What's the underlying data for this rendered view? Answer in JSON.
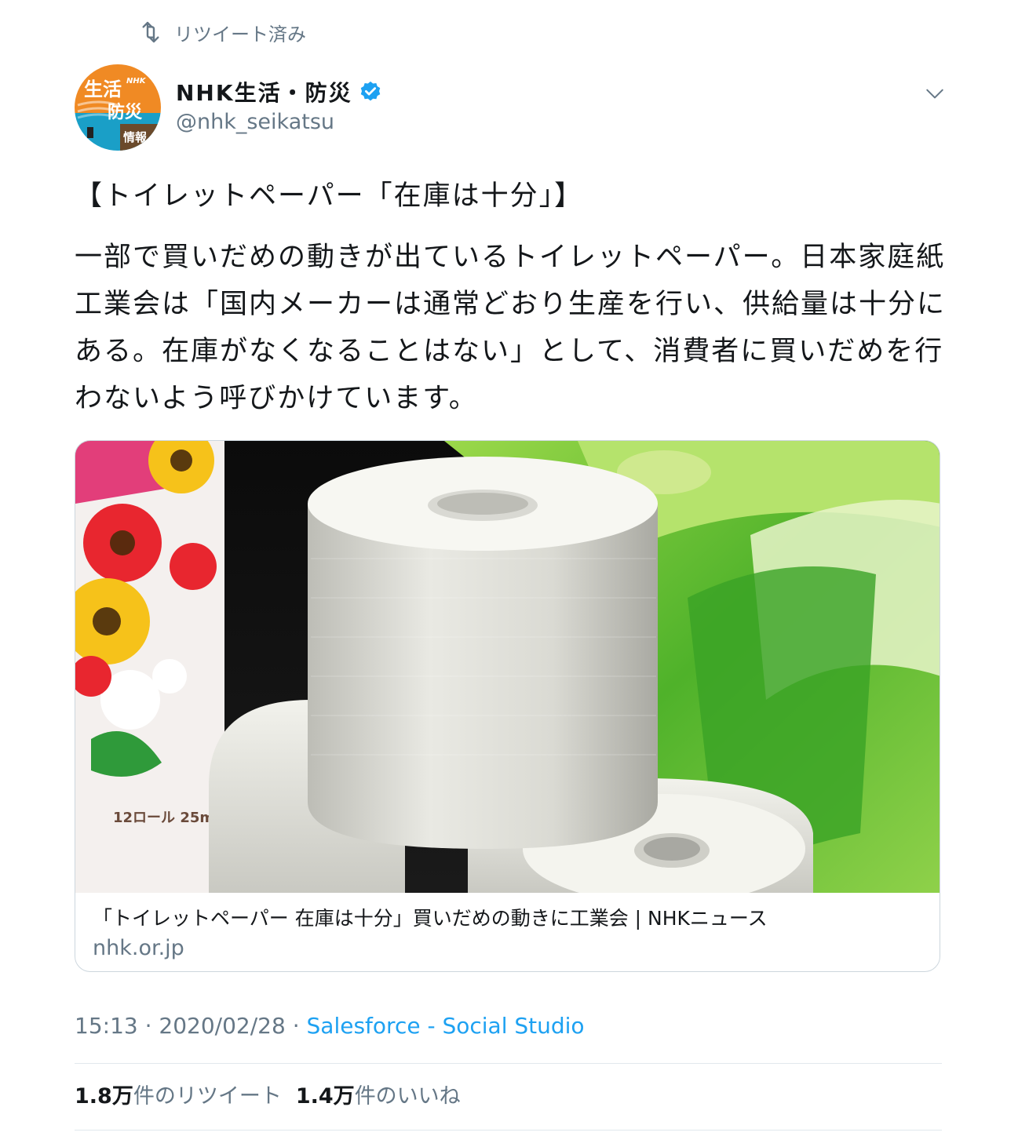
{
  "retweet": {
    "label": "リツイート済み",
    "icon": "retweet-icon"
  },
  "author": {
    "display_name": "NHK生活・防災",
    "handle": "@nhk_seikatsu",
    "verified": true,
    "avatar_lines": [
      "生活",
      "防災",
      "情報"
    ],
    "avatar_brand": "NHK",
    "colors": {
      "avatar_orange": "#f08a24",
      "avatar_teal": "#1a9fc7",
      "avatar_brown": "#6b4a2b",
      "verified_blue": "#1da1f2"
    }
  },
  "tweet": {
    "title": "【トイレットペーパー「在庫は十分」】",
    "body": "一部で買いだめの動きが出ているトイレットペーパー。日本家庭紙工業会は「国内メーカーは通常どおり生産を行い、供給量は十分にある。在庫がなくなることはない」として、消費者に買いだめを行わないよう呼びかけています。"
  },
  "card": {
    "title": "「トイレットペーパー 在庫は十分」買いだめの動きに工業会 | NHKニュース",
    "domain": "nhk.or.jp",
    "image_text_left": "12ロール 25m"
  },
  "meta": {
    "time": "15:13",
    "date": "2020/02/28",
    "separator": "·",
    "source": "Salesforce - Social Studio"
  },
  "stats": {
    "retweets_count": "1.8万",
    "retweets_label": "件のリツイート",
    "likes_count": "1.4万",
    "likes_label": "件のいいね"
  },
  "colors": {
    "text": "#14171a",
    "muted": "#657786",
    "link": "#1da1f2",
    "border": "#e1e8ed"
  }
}
